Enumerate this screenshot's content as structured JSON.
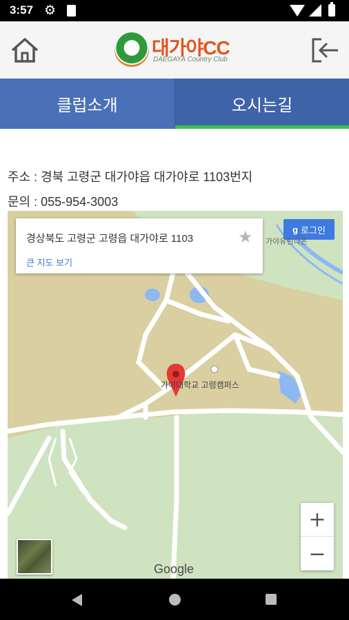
{
  "status_bar": {
    "time": "3:57"
  },
  "header": {
    "brand_name": "대가야CC",
    "brand_subtitle": "DAEGAYA Country Club"
  },
  "tabs": [
    {
      "label": "클럽소개",
      "selected": false
    },
    {
      "label": "오시는길",
      "selected": true
    }
  ],
  "info": {
    "address": "주소 : 경북 고령군 대가야읍 대가야로 1103번지",
    "phone": "문의 : 055-954-3003"
  },
  "map": {
    "place_title": "경상북도 고령군 고령읍 대가야로 1103",
    "place_link": "큰 지도 보기",
    "login_button": "로그인",
    "north_label": "가야유린다온",
    "campus_label": "가야대학교 고령캠퍼스",
    "zoom_in": "+",
    "zoom_out": "−",
    "provider": "Google",
    "colors": {
      "land": "#d9cfa1",
      "green": "#cfe3c0",
      "water": "#8db8f2",
      "road": "#ffffff",
      "marker": "#e53935"
    }
  }
}
